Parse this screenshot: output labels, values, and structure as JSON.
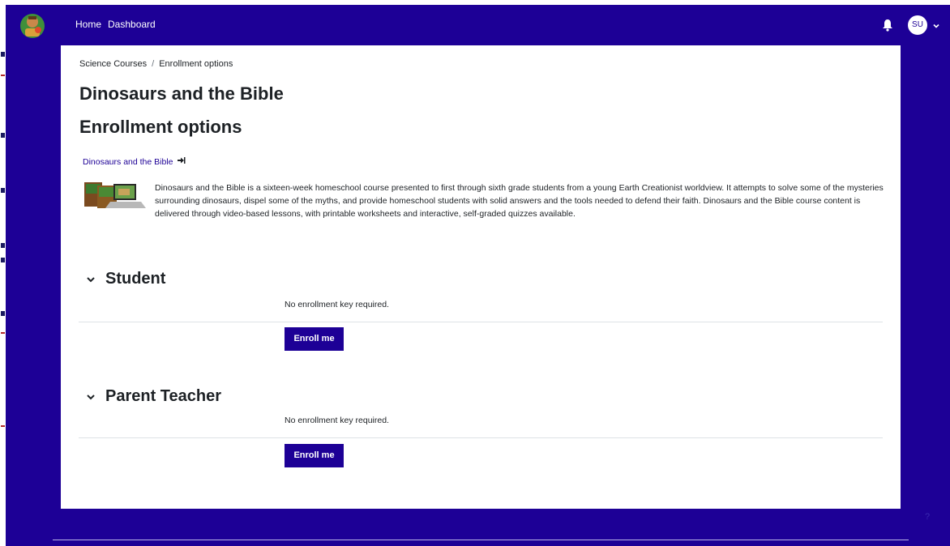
{
  "navbar": {
    "links": [
      "Home",
      "Dashboard"
    ],
    "user_initials": "SU"
  },
  "breadcrumb": {
    "items": [
      "Science Courses",
      "Enrollment options"
    ],
    "separator": "/"
  },
  "course": {
    "title": "Dinosaurs and the Bible",
    "page_title": "Enrollment options",
    "link_text": "Dinosaurs and the Bible",
    "summary": "Dinosaurs and the Bible is a sixteen-week homeschool course presented to first through sixth grade students from a young Earth Creationist worldview. It attempts to solve some of the mysteries surrounding dinosaurs, dispel some of the myths, and provide homeschool students with solid answers and the tools needed to defend their faith. Dinosaurs and the Bible course content is delivered through video-based lessons, with printable worksheets and interactive, self-graded quizzes available."
  },
  "sections": [
    {
      "title": "Student",
      "note": "No enrollment key required.",
      "button": "Enroll me"
    },
    {
      "title": "Parent Teacher",
      "note": "No enrollment key required.",
      "button": "Enroll me"
    }
  ],
  "icons": {
    "logo": "site-logo-icon",
    "bell": "notification-bell-icon",
    "caret": "chevron-down-icon",
    "enter": "sign-in-icon"
  },
  "colors": {
    "brand": "#1d0096",
    "card": "#ffffff",
    "text": "#1d2125"
  }
}
